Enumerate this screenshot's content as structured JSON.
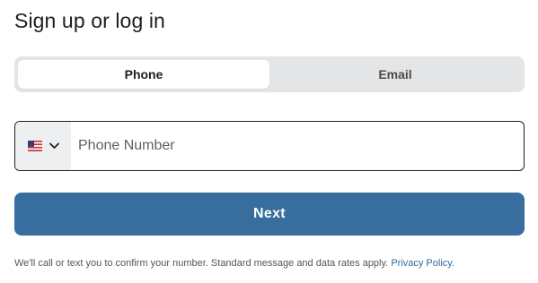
{
  "title": "Sign up or log in",
  "tabs": [
    {
      "label": "Phone",
      "active": true
    },
    {
      "label": "Email",
      "active": false
    }
  ],
  "phone": {
    "country_flag": "us-flag-icon",
    "placeholder": "Phone Number",
    "value": ""
  },
  "next_button": {
    "label": "Next"
  },
  "disclaimer": {
    "text": "We'll call or text you to confirm your number. Standard message and data rates apply.",
    "link_label": "Privacy Policy."
  },
  "colors": {
    "primary_button": "#376e9e",
    "link": "#2f6a9e",
    "segment_bg": "#e4e5e7"
  }
}
